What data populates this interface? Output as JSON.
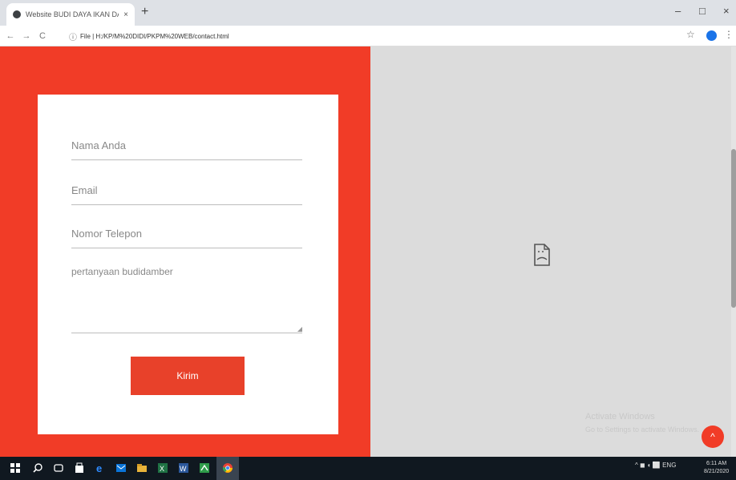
{
  "browser": {
    "tab_title": "Website BUDI DAYA IKAN DAN ...",
    "tab_close": "×",
    "new_tab": "+",
    "window_minimize": "–",
    "window_maximize": "□",
    "window_close": "×",
    "nav_back": "←",
    "nav_forward": "→",
    "nav_reload": "C",
    "address_info": "ⓘ",
    "address_url": "File | H:/KP/M%20DIDI/PKPM%20WEB/contact.html",
    "bookmark_star": "☆",
    "menu_kebab": "⋮"
  },
  "form": {
    "name_placeholder": "Nama Anda",
    "email_placeholder": "Email",
    "phone_placeholder": "Nomor Telepon",
    "question_value": "pertanyaan budidamber",
    "submit_label": "Kirim"
  },
  "right_pane": {
    "watermark_title": "Activate Windows",
    "watermark_sub": "Go to Settings to activate Windows.",
    "scroll_top_label": "^"
  },
  "taskbar": {
    "tray_text": "^ ◼ ◖ ⬜ ENG",
    "time": "6:11 AM",
    "date": "8/21/2020"
  },
  "colors": {
    "left_bg": "#f13c27",
    "button": "#e8412a",
    "right_bg": "#dcdcdc"
  }
}
